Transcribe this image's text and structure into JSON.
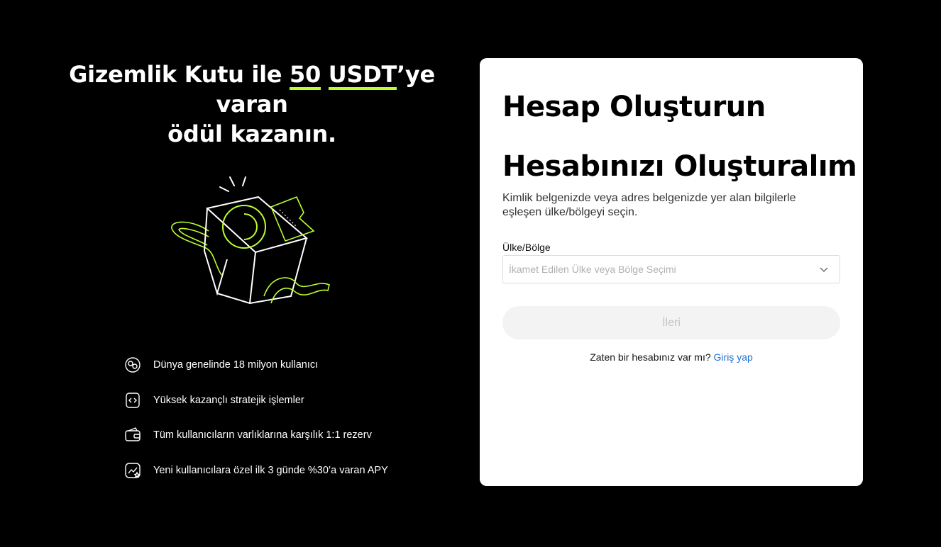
{
  "promo": {
    "title_part1": "Gizemlik Kutu ile ",
    "title_highlight1": "50",
    "title_space": " ",
    "title_highlight2": "USDT",
    "title_part2": "’ye varan",
    "title_line2": "ödül kazanın.",
    "highlight_color": "#bcff2f"
  },
  "features": [
    {
      "icon": "globe-users-icon",
      "text": "Dünya genelinde 18 milyon kullanıcı"
    },
    {
      "icon": "code-doc-icon",
      "text": "Yüksek kazançlı stratejik işlemler"
    },
    {
      "icon": "wallet-icon",
      "text": "Tüm kullanıcıların varlıklarına karşılık 1:1 rezerv"
    },
    {
      "icon": "chart-star-icon",
      "text": "Yeni kullanıcılara özel ilk 3 günde %30’a varan APY"
    }
  ],
  "form": {
    "title": "Hesap Oluşturun",
    "subtitle": "Hesabınızı Oluşturalım",
    "description": "Kimlik belgenizde veya adres belgenizde yer alan bilgilerle eşleşen ülke/bölgeyi seçin.",
    "country_label": "Ülke/Bölge",
    "country_placeholder": "İkamet Edilen Ülke veya Bölge Seçimi",
    "next_button": "İleri",
    "have_account": "Zaten bir hesabınız var mı?",
    "login_link": "Giriş yap",
    "link_color": "#1f6fd1"
  }
}
